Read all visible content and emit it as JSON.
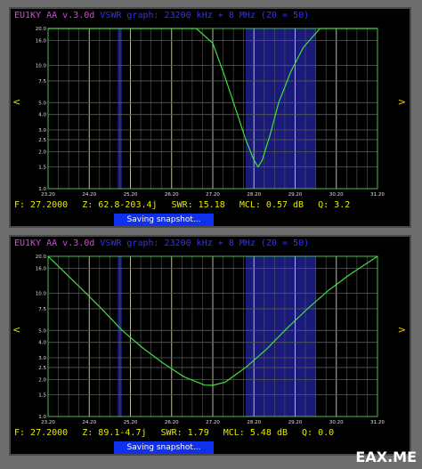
{
  "screens": [
    {
      "app_title": "EU1KY AA v.3.0d",
      "mode_title": "VSWR graph: 23200 kHz + 8 MHz",
      "z0": "(Z0 = 50)",
      "left_arrow": "<",
      "right_arrow": ">",
      "status": {
        "f": "F: 27.2000",
        "z": "Z: 62.8-203.4j",
        "swr": "SWR: 15.18",
        "mcl": "MCL: 0.57 dB",
        "q": "Q: 3.2"
      },
      "snapshot_label": "Saving snapshot..."
    },
    {
      "app_title": "EU1KY AA v.3.0d",
      "mode_title": "VSWR graph: 23200 kHz + 8 MHz",
      "z0": "(Z0 = 50)",
      "left_arrow": "<",
      "right_arrow": ">",
      "status": {
        "f": "F: 27.2000",
        "z": "Z: 89.1-4.7j",
        "swr": "SWR: 1.79",
        "mcl": "MCL: 5.48 dB",
        "q": "Q: 0.0"
      },
      "snapshot_label": "Saving snapshot..."
    }
  ],
  "watermark": "EAX.ME",
  "colors": {
    "app_title": "#e040e0",
    "mode_title": "#3030ff",
    "status_text": "#e8e800",
    "curve": "#40e040",
    "band": "#1a1a7a",
    "grid": "#5a5a5a",
    "frame": "#4ec04e"
  },
  "chart_data": [
    {
      "type": "line",
      "title": "VSWR graph: 23200 kHz + 8 MHz",
      "x_ticks": [
        "23.20",
        "24.20",
        "25.20",
        "26.20",
        "27.20",
        "28.20",
        "29.20",
        "30.20",
        "31.20"
      ],
      "y_ticks": [
        "20.0",
        "16.0",
        "10.0",
        "7.5",
        "5.0",
        "4.0",
        "3.0",
        "2.5",
        "2.0",
        "1.5",
        "1.0"
      ],
      "xlim": [
        23.2,
        31.2
      ],
      "ylim": [
        1.0,
        20.0
      ],
      "bands": [
        [
          24.89,
          24.99
        ],
        [
          28.0,
          29.7
        ]
      ],
      "series": [
        {
          "x": [
            23.2,
            26.8,
            27.2,
            27.5,
            27.8,
            28.0,
            28.2,
            28.3,
            28.4,
            28.6,
            28.8,
            29.1,
            29.4,
            29.8,
            30.0,
            31.2
          ],
          "values": [
            20.0,
            20.0,
            15.18,
            8.0,
            4.0,
            2.5,
            1.7,
            1.5,
            1.7,
            2.8,
            5.0,
            9.0,
            14.0,
            20.0,
            20.0,
            20.0
          ]
        }
      ]
    },
    {
      "type": "line",
      "title": "VSWR graph: 23200 kHz + 8 MHz",
      "x_ticks": [
        "23.20",
        "24.20",
        "25.20",
        "26.20",
        "27.20",
        "28.20",
        "29.20",
        "30.20",
        "31.20"
      ],
      "y_ticks": [
        "20.0",
        "16.0",
        "10.0",
        "7.5",
        "5.0",
        "4.0",
        "3.0",
        "2.5",
        "2.0",
        "1.5",
        "1.0"
      ],
      "xlim": [
        23.2,
        31.2
      ],
      "ylim": [
        1.0,
        20.0
      ],
      "bands": [
        [
          24.89,
          24.99
        ],
        [
          28.0,
          29.7
        ]
      ],
      "series": [
        {
          "x": [
            23.2,
            23.5,
            24.0,
            24.5,
            25.0,
            25.5,
            26.0,
            26.5,
            27.0,
            27.2,
            27.5,
            28.0,
            28.5,
            29.0,
            29.5,
            30.0,
            30.5,
            31.2
          ],
          "values": [
            20.0,
            16.0,
            11.0,
            7.5,
            5.0,
            3.6,
            2.7,
            2.1,
            1.8,
            1.79,
            1.9,
            2.5,
            3.5,
            5.2,
            7.5,
            10.5,
            14.0,
            20.0
          ]
        }
      ]
    }
  ]
}
